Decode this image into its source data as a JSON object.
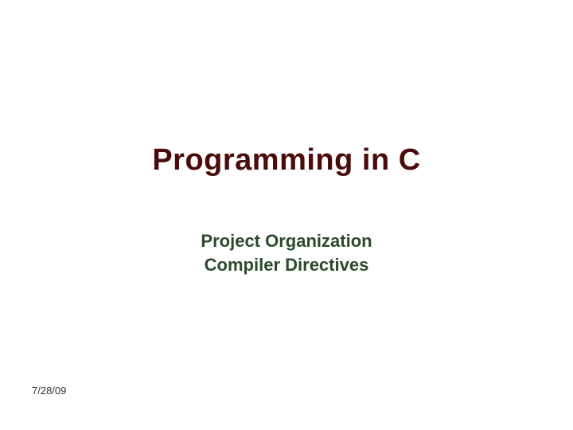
{
  "slide": {
    "title": "Programming in C",
    "subtitle_line1": "Project Organization",
    "subtitle_line2": "Compiler Directives",
    "date": "7/28/09"
  }
}
